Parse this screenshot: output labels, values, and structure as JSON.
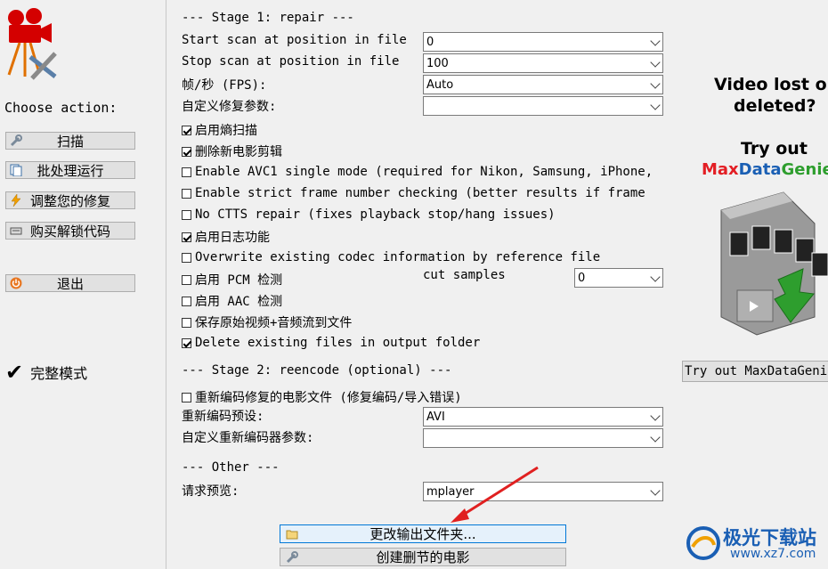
{
  "left_panel": {
    "choose_label": "Choose action:",
    "buttons": {
      "scan": "扫描",
      "batch": "批处理运行",
      "adjust": "调整您的修复",
      "buy": "购买解锁代码",
      "exit": "退出"
    },
    "full_mode": "完整模式"
  },
  "stage1": {
    "header": "--- Stage 1: repair ---",
    "start_label": "Start scan at position in file",
    "start_value": "0",
    "stop_label": "Stop scan at position in file",
    "stop_value": "100",
    "fps_label": "帧/秒 (FPS):",
    "fps_value": "Auto",
    "custom_label": "自定义修复参数:",
    "custom_value": "",
    "options": [
      {
        "label": "启用熵扫描",
        "checked": true
      },
      {
        "label": "删除新电影剪辑",
        "checked": true
      },
      {
        "label": "Enable AVC1 single mode (required for Nikon, Samsung, iPhone,",
        "checked": false
      },
      {
        "label": "Enable strict frame number checking (better results if frame",
        "checked": false
      },
      {
        "label": "No CTTS repair (fixes playback stop/hang issues)",
        "checked": false
      },
      {
        "label": "启用日志功能",
        "checked": true
      },
      {
        "label": "Overwrite existing codec information by reference file",
        "checked": false
      },
      {
        "label": "启用 PCM 检测",
        "checked": false
      },
      {
        "label": "启用 AAC 检测",
        "checked": false
      },
      {
        "label": "保存原始视频+音频流到文件",
        "checked": false
      },
      {
        "label": "Delete existing files in output folder",
        "checked": true
      }
    ],
    "cut_samples_label": "cut samples",
    "cut_samples_value": "0"
  },
  "stage2": {
    "header": "--- Stage 2: reencode (optional) ---",
    "reencode_label": "重新编码修复的电影文件 (修复编码/导入错误)",
    "reencode_checked": false,
    "preset_label": "重新编码预设:",
    "preset_value": "AVI",
    "custom_label": "自定义重新编码器参数:",
    "custom_value": ""
  },
  "other": {
    "header": "--- Other ---",
    "preview_label": "请求预览:",
    "preview_value": "mplayer"
  },
  "bottom_buttons": {
    "change_output": "更改输出文件夹...",
    "create_cut": "创建删节的电影"
  },
  "ad": {
    "line1": "Video lost or",
    "line2": "deleted?",
    "line3": "Try out",
    "brand": "MaxDataGenie",
    "button": "Try out MaxDataGenie"
  },
  "watermark": {
    "title": "极光下载站",
    "url": "www.xz7.com"
  },
  "colors": {
    "accent_blue": "#0078d7",
    "brand_red": "#e31e24",
    "brand_green": "#2e9e2e",
    "brand_blue": "#1a5fb4",
    "arrow_red": "#e02020"
  }
}
